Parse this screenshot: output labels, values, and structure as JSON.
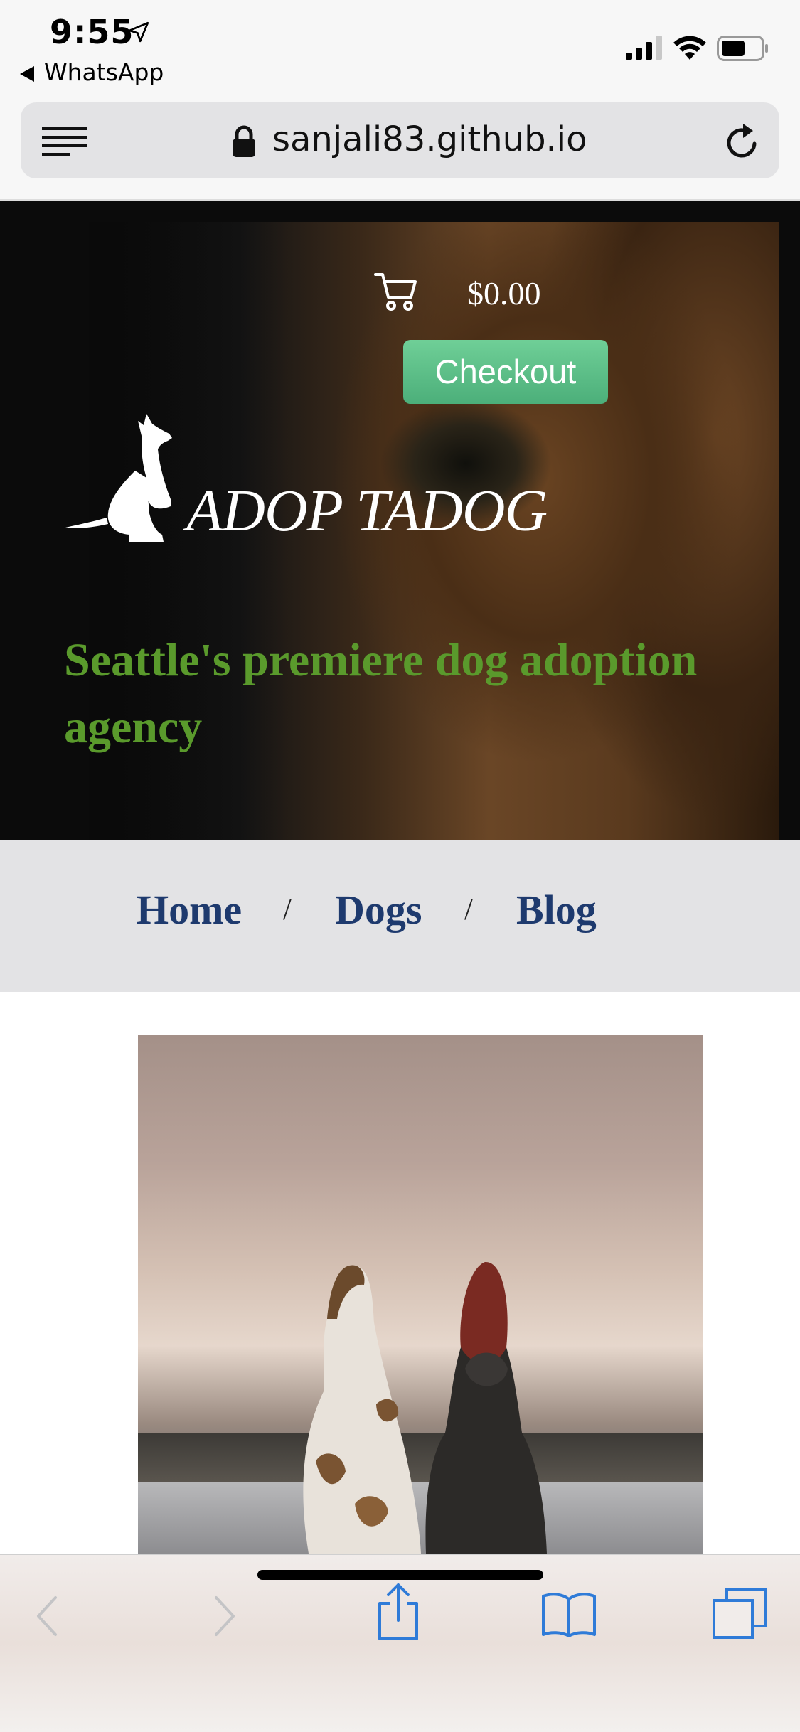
{
  "status_bar": {
    "time": "9:55",
    "back_app": "WhatsApp"
  },
  "browser": {
    "url": "sanjali83.github.io"
  },
  "hero": {
    "cart_total": "$0.00",
    "checkout_label": "Checkout",
    "brand": "ADOP TADOG",
    "tagline": "Seattle's premiere dog adoption agency"
  },
  "nav": {
    "items": [
      {
        "label": "Home"
      },
      {
        "label": "Dogs"
      },
      {
        "label": "Blog"
      }
    ],
    "separator": "/"
  },
  "colors": {
    "accent_green": "#5a9a2c",
    "nav_blue": "#1e3a6e",
    "checkout_green": "#5dbf88",
    "ios_blue": "#2f7bd8"
  },
  "icons": {
    "toolbar": [
      "back-arrow-icon",
      "forward-arrow-icon",
      "share-icon",
      "bookmarks-icon",
      "tabs-icon"
    ]
  }
}
